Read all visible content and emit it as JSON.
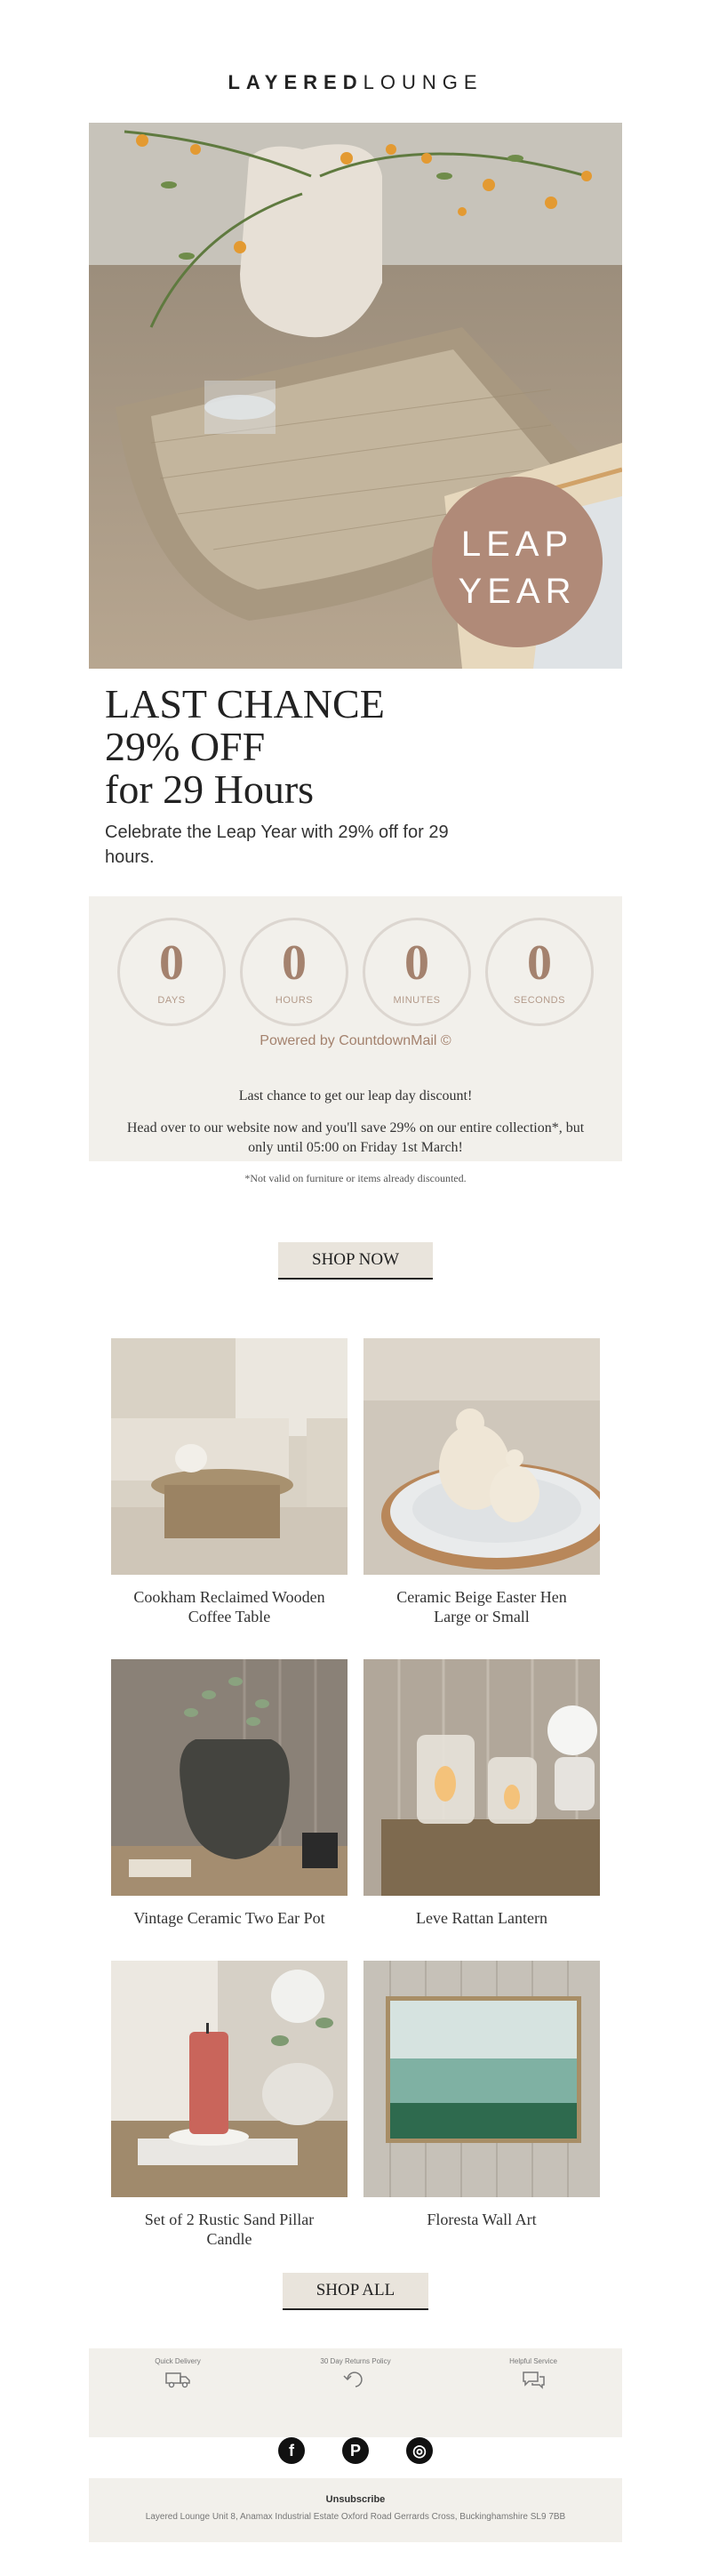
{
  "brand": {
    "logo_bold": "LAYERED",
    "logo_light": "LOUNGE"
  },
  "hero": {
    "badge_line1": "LEAP",
    "badge_line2": "YEAR"
  },
  "headline": {
    "line1": "LAST CHANCE",
    "line2": "29% OFF",
    "line3": "for 29 Hours",
    "subtitle": "Celebrate the Leap Year with 29% off for 29 hours."
  },
  "countdown": {
    "units": [
      {
        "value": "0",
        "label": "DAYS"
      },
      {
        "value": "0",
        "label": "HOURS"
      },
      {
        "value": "0",
        "label": "MINUTES"
      },
      {
        "value": "0",
        "label": "SECONDS"
      }
    ],
    "powered_by": "Powered by CountdownMail ©",
    "message1": "Last chance to get our leap day discount!",
    "message2": "Head over to our website now and you'll save 29% on our entire collection*, but only until 05:00 on Friday 1st March!",
    "note": "*Not valid on furniture or items already discounted."
  },
  "cta": {
    "shop_now": "SHOP NOW",
    "shop_all": "SHOP ALL"
  },
  "products": [
    {
      "name": "Cookham Reclaimed Wooden Coffee Table"
    },
    {
      "name": "Ceramic Beige Easter Hen Large or Small"
    },
    {
      "name": "Vintage Ceramic Two Ear Pot"
    },
    {
      "name": "Leve Rattan Lantern"
    },
    {
      "name": "Set of 2 Rustic Sand Pillar Candle"
    },
    {
      "name": "Floresta Wall Art"
    }
  ],
  "footer": {
    "usps": [
      {
        "label": "Quick Delivery",
        "icon": "truck-icon"
      },
      {
        "label": "30 Day Returns Policy",
        "icon": "returns-icon"
      },
      {
        "label": "Helpful Service",
        "icon": "chat-icon"
      }
    ],
    "social": [
      {
        "icon": "facebook-icon",
        "glyph": "f"
      },
      {
        "icon": "pinterest-icon",
        "glyph": "P"
      },
      {
        "icon": "instagram-icon",
        "glyph": "◎"
      }
    ],
    "unsubscribe": "Unsubscribe",
    "address": "Layered Lounge Unit 8, Anamax Industrial Estate Oxford Road Gerrards Cross, Buckinghamshire SL9 7BB"
  },
  "colors": {
    "accent": "#a4826e",
    "panel": "#f2f0eb",
    "button": "#e9e4dc"
  }
}
